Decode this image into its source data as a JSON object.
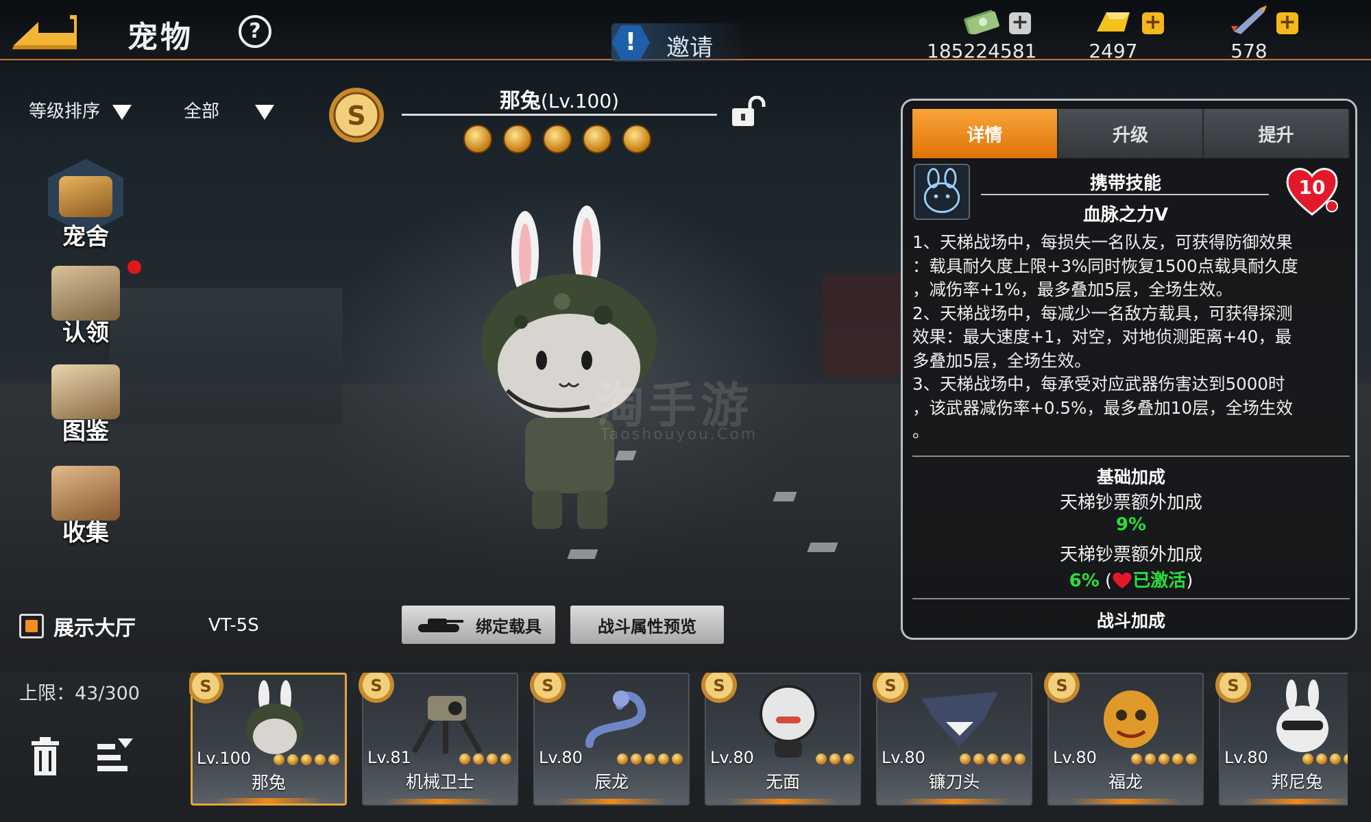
{
  "header": {
    "title": "宠物",
    "help_glyph": "?",
    "invite_label": "邀请",
    "currencies": [
      {
        "name": "cash-icon",
        "value": "185224581",
        "plus_color": "#cfcfcf"
      },
      {
        "name": "gold-bar-icon",
        "value": "2497",
        "plus_color": "#f2b81e"
      },
      {
        "name": "rocket-icon",
        "value": "578",
        "plus_color": "#f2b81e"
      }
    ]
  },
  "filters": {
    "sort_label": "等级排序",
    "category_label": "全部"
  },
  "side_menu": [
    {
      "id": "kennel",
      "label": "宠舍",
      "icon": "kennel-icon"
    },
    {
      "id": "adopt",
      "label": "认领",
      "icon": "crate-icon"
    },
    {
      "id": "codex",
      "label": "图鉴",
      "icon": "book-icon"
    },
    {
      "id": "collect",
      "label": "收集",
      "icon": "box-icon"
    }
  ],
  "pet": {
    "name": "那兔",
    "level_text": "(Lv.100)",
    "star_count": 5
  },
  "watermark": {
    "main": "淘手游",
    "sub": "Taoshouyou.Com"
  },
  "controls": {
    "showcase_label": "展示大厅",
    "vehicle_name": "VT-5S",
    "bind_vehicle_label": "绑定载具",
    "battle_preview_label": "战斗属性预览"
  },
  "detail_panel": {
    "tabs": [
      {
        "label": "详情",
        "active": true
      },
      {
        "label": "升级",
        "active": false
      },
      {
        "label": "提升",
        "active": false
      }
    ],
    "skill_heading": "携带技能",
    "skill_name": "血脉之力Ⅴ",
    "heart_value": "10",
    "description_lines": [
      "1、天梯战场中，每损失一名队友，可获得防御效果",
      "：载具耐久度上限+3%同时恢复1500点载具耐久度",
      "，减伤率+1%，最多叠加5层，全场生效。",
      "2、天梯战场中，每减少一名敌方载具，可获得探测",
      "效果：最大速度+1，对空，对地侦测距离+40，最",
      "多叠加5层，全场生效。",
      "3、天梯战场中，每承受对应武器伤害达到5000时",
      "，该武器减伤率+0.5%，最多叠加10层，全场生效",
      "。"
    ],
    "base_bonus_title": "基础加成",
    "bonus_1_label": "天梯钞票额外加成",
    "bonus_1_value": "9%",
    "bonus_2_label": "天梯钞票额外加成",
    "bonus_2_value": "6%",
    "bonus_2_paren_open": "(",
    "bonus_2_status": "已激活",
    "bonus_2_paren_close": ")",
    "battle_bonus_title": "战斗加成"
  },
  "bottom": {
    "capacity_label": "上限：43/300"
  },
  "pet_list": [
    {
      "level": "Lv.100",
      "name": "那兔",
      "stars": 5,
      "selected": true,
      "icon": "rabbit-soldier-icon"
    },
    {
      "level": "Lv.81",
      "name": "机械卫士",
      "stars": 4,
      "selected": false,
      "icon": "mech-guard-icon"
    },
    {
      "level": "Lv.80",
      "name": "辰龙",
      "stars": 5,
      "selected": false,
      "icon": "dragon-icon"
    },
    {
      "level": "Lv.80",
      "name": "无面",
      "stars": 3,
      "selected": false,
      "icon": "faceless-icon"
    },
    {
      "level": "Lv.80",
      "name": "镰刀头",
      "stars": 5,
      "selected": false,
      "icon": "shark-icon"
    },
    {
      "level": "Lv.80",
      "name": "福龙",
      "stars": 5,
      "selected": false,
      "icon": "lucky-dragon-icon"
    },
    {
      "level": "Lv.80",
      "name": "邦尼兔",
      "stars": 5,
      "selected": false,
      "icon": "bunny-icon"
    }
  ],
  "colors": {
    "accent_orange": "#f08a16",
    "highlight_green": "#27e03a",
    "alert_red": "#e01818"
  }
}
